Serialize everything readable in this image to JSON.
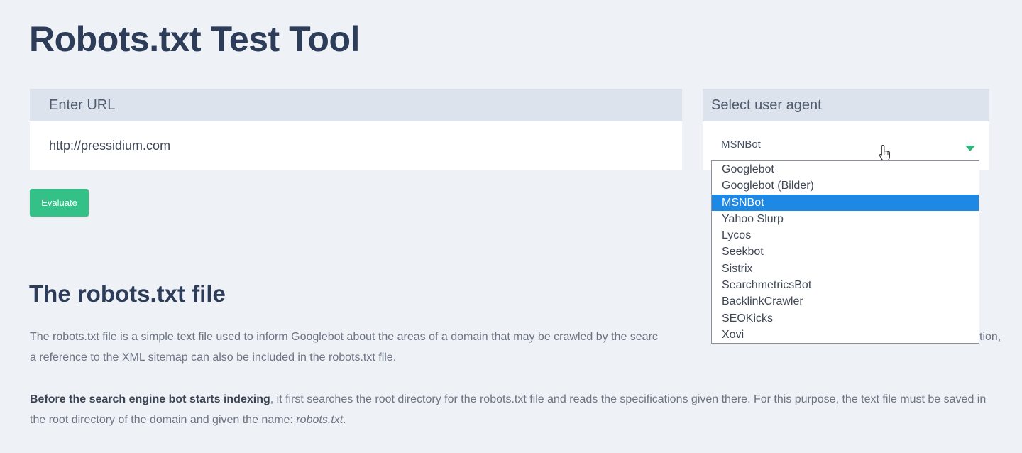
{
  "page": {
    "title": "Robots.txt Test Tool"
  },
  "url_panel": {
    "header": "Enter URL",
    "value": "http://pressidium.com"
  },
  "agent_panel": {
    "header": "Select user agent",
    "selected": "MSNBot",
    "options": [
      "Googlebot",
      "Googlebot (Bilder)",
      "MSNBot",
      "Yahoo Slurp",
      "Lycos",
      "Seekbot",
      "Sistrix",
      "SearchmetricsBot",
      "BacklinkCrawler",
      "SEOKicks",
      "Xovi"
    ]
  },
  "evaluate_button": {
    "label": "Evaluate"
  },
  "section": {
    "heading": "The robots.txt file",
    "paragraph1_visible": "The robots.txt file is a simple text file used to inform Googlebot about the areas of a domain that may be crawled by the searc",
    "paragraph1_tail": "tion,",
    "paragraph1_line2": "a reference to the XML sitemap can also be included in the robots.txt file.",
    "paragraph2_bold": "Before the search engine bot starts indexing",
    "paragraph2_text": ", it first searches the root directory for the robots.txt file and reads the specifications given there. For this purpose, the text file must be saved in the root directory of the domain and given the name: ",
    "paragraph2_italic": "robots.txt",
    "paragraph2_end": "."
  },
  "colors": {
    "background": "#eef1f5",
    "panel_header": "#dde3ec",
    "title": "#2d3c58",
    "button": "#34c187",
    "caret": "#2fb67b",
    "selected_option": "#1e88e5"
  }
}
